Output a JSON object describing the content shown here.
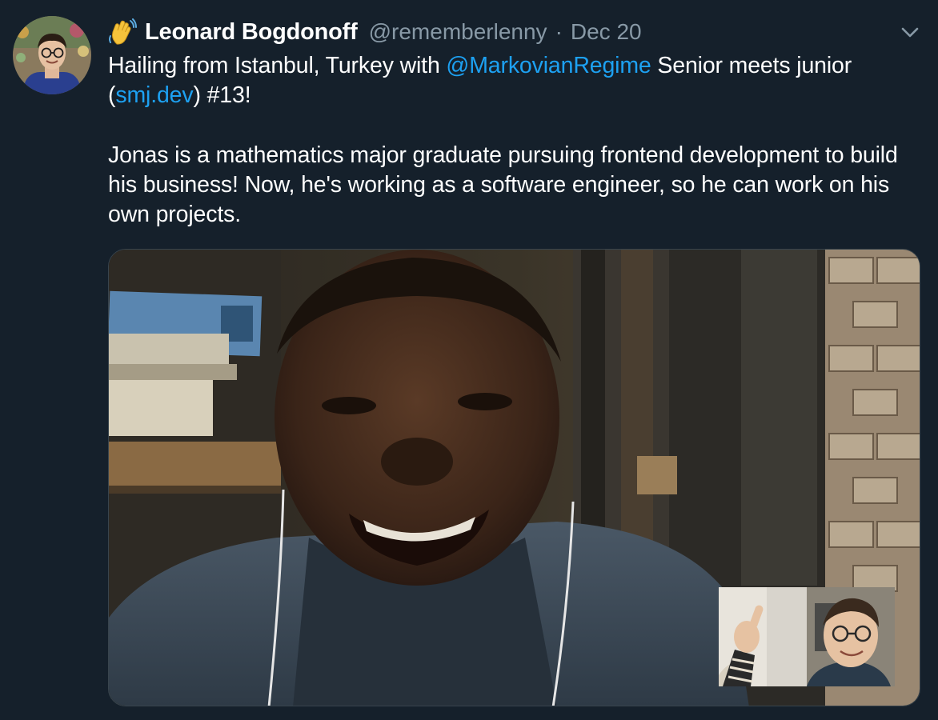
{
  "tweet": {
    "author": {
      "emoji_icon": "waving-hand-icon",
      "display_name": "Leonard Bogdonoff",
      "handle": "@rememberlenny",
      "separator": "·",
      "date": "Dec 20"
    },
    "text": {
      "line1_before": "Hailing from Istanbul, Turkey with ",
      "mention": "@MarkovianRegime",
      "line1_after": " Senior meets junior",
      "paren_open": "(",
      "link": "smj.dev",
      "line2_after": ") #13!",
      "paragraph2": "Jonas is a mathematics major graduate pursuing frontend development to build his business! Now, he's working as a software engineer, so he can work on his own projects."
    },
    "menu_icon": "chevron-down-icon"
  },
  "colors": {
    "background": "#15202b",
    "text": "#ffffff",
    "muted": "#8899a6",
    "link": "#1da1f2",
    "border": "#38444d"
  }
}
